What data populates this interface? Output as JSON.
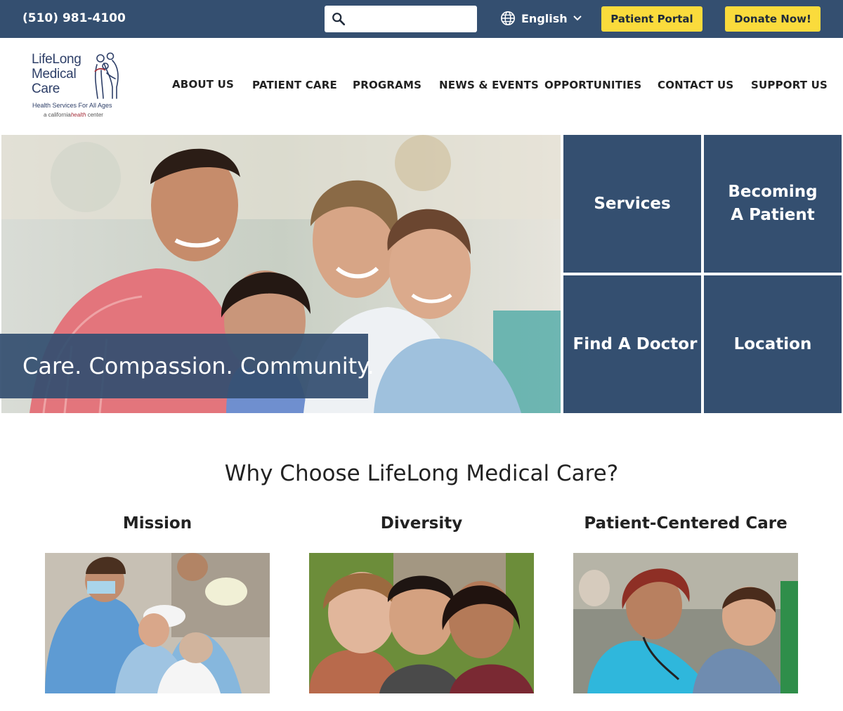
{
  "topbar": {
    "phone": "(510) 981-4100",
    "search": {
      "placeholder": "",
      "icon": "search-icon"
    },
    "language": {
      "label": "English",
      "icon": "globe-icon"
    },
    "patient_portal": "Patient Portal",
    "donate": "Donate Now!"
  },
  "logo": {
    "line1": "LifeLong",
    "line2": "Medical",
    "line3": "Care",
    "tagline": "Health Services For All Ages",
    "sub_a": "a california",
    "sub_b": "health",
    "sub_c": " center"
  },
  "nav": [
    "ABOUT US",
    "PATIENT CARE",
    "PROGRAMS",
    "NEWS & EVENTS",
    "OPPORTUNITIES",
    "CONTACT US",
    "SUPPORT US"
  ],
  "hero": {
    "caption": "Care. Compassion. Community."
  },
  "tiles": [
    {
      "label": "Services"
    },
    {
      "label": "Becoming A Patient"
    },
    {
      "label": "Find A Doctor"
    },
    {
      "label": "Location"
    }
  ],
  "why": {
    "title": "Why Choose LifeLong Medical Care?",
    "columns": [
      {
        "title": "Mission"
      },
      {
        "title": "Diversity"
      },
      {
        "title": "Patient-Centered Care"
      }
    ]
  },
  "colors": {
    "brand_navy": "#344f70",
    "accent_yellow": "#fadb3c",
    "logo_red": "#a7343f"
  }
}
